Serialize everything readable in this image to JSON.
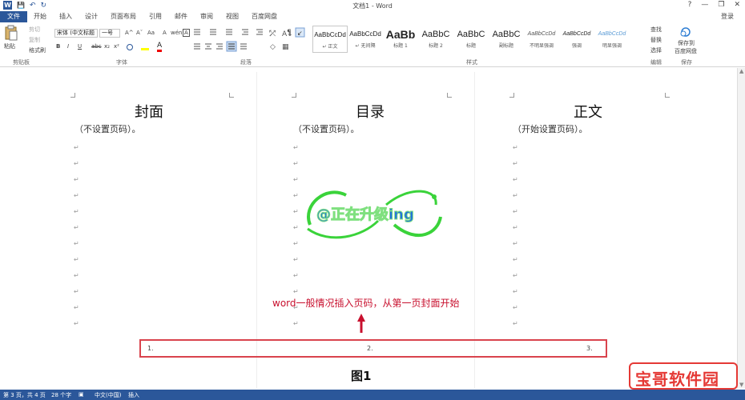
{
  "window": {
    "title": "文档1 - Word",
    "help": "?",
    "minimize": "—",
    "restore": "❐",
    "close": "✕",
    "login": "登录"
  },
  "qat": {
    "logo": "W",
    "save": "💾",
    "undo": "↶",
    "redo": "↻"
  },
  "tabs": [
    "文件",
    "开始",
    "插入",
    "设计",
    "页面布局",
    "引用",
    "邮件",
    "审阅",
    "视图",
    "百度网盘"
  ],
  "ribbon": {
    "clipboard": {
      "paste": "粘贴",
      "cut": "剪切",
      "copy": "复制",
      "format_painter": "格式刷",
      "label": "剪贴板"
    },
    "font": {
      "name": "宋体 (中文标题",
      "size": "一号",
      "label": "字体",
      "bold": "B",
      "italic": "I",
      "underline": "U",
      "strike": "abc",
      "sub": "x₂",
      "sup": "x²",
      "grow": "A^",
      "shrink": "Aˇ",
      "case": "Aa",
      "clear": "A",
      "wen": "wén",
      "frame": "A"
    },
    "paragraph": {
      "label": "段落"
    },
    "styles": {
      "label": "样式",
      "items": [
        {
          "preview": "AaBbCcDd",
          "name": "↵ 正文"
        },
        {
          "preview": "AaBbCcDd",
          "name": "↵ 无间隔"
        },
        {
          "preview": "AaBb",
          "name": "标题 1"
        },
        {
          "preview": "AaBbC",
          "name": "标题 2"
        },
        {
          "preview": "AaBbC",
          "name": "标题"
        },
        {
          "preview": "AaBbC",
          "name": "副标题"
        },
        {
          "preview": "AaBbCcDd",
          "name": "不明显强调"
        },
        {
          "preview": "AaBbCcDd",
          "name": "强调"
        },
        {
          "preview": "AaBbCcDd",
          "name": "明显强调"
        }
      ]
    },
    "editing": {
      "find": "查找",
      "replace": "替换",
      "select": "选择",
      "label": "编辑"
    },
    "save": {
      "line1": "保存到",
      "line2": "百度网盘",
      "label": "保存"
    }
  },
  "document": {
    "columns": [
      {
        "title": "封面",
        "subtitle": "（不设置页码）。"
      },
      {
        "title": "目录",
        "subtitle": "（不设置页码）。"
      },
      {
        "title": "正文",
        "subtitle": "（开始设置页码）。"
      }
    ],
    "para_mark": "↵",
    "page_numbers": [
      "1.",
      "2.",
      "3."
    ],
    "annotation": "word一般情况插入页码，从第一页封面开始",
    "figure_label": "图1",
    "overlay_text": "@正在升级ing"
  },
  "status": {
    "page": "第 3 页，共 4 页",
    "words": "28 个字",
    "lang": "中文(中国)",
    "mode": "插入"
  },
  "watermark": "宝哥软件园",
  "colors": {
    "accent": "#2b579a",
    "red": "#d9434d",
    "annot": "#c8102e",
    "overlay_green": "#3ad33a",
    "overlay_text": "#1f6fe0"
  }
}
